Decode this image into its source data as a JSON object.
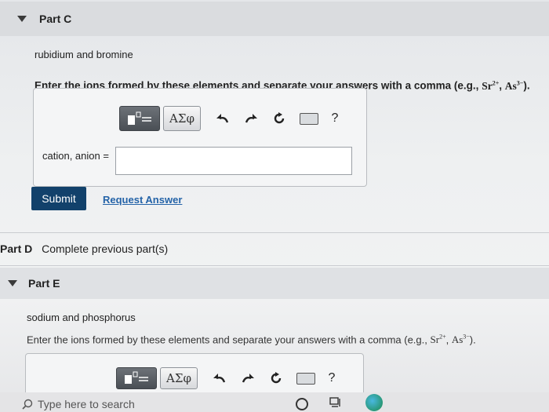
{
  "part_c": {
    "title": "Part C",
    "elements": "rubidium and bromine",
    "instruction": "Enter the ions formed by these elements and separate your answers with a comma (e.g.,",
    "example_a": "Sr",
    "example_a_sup": "2+",
    "example_sep": ",",
    "example_b": "As",
    "example_b_sup": "3−",
    "example_end": ").",
    "toolbar": {
      "greek_label": "ΑΣφ",
      "undo_icon": "undo-arrow-icon",
      "redo_icon": "redo-arrow-icon",
      "reset_icon": "reset-icon",
      "keyboard_icon": "keyboard-icon",
      "help_label": "?"
    },
    "field_label": "cation, anion =",
    "field_value": "",
    "submit_label": "Submit",
    "request_label": "Request Answer"
  },
  "part_d": {
    "title": "Part D",
    "status": "Complete previous part(s)"
  },
  "part_e": {
    "title": "Part E",
    "elements": "sodium and phosphorus",
    "instruction": "Enter the ions formed by these elements and separate your answers with a comma (e.g.,",
    "example_a": "Sr",
    "example_a_sup": "2+",
    "example_sep": ",",
    "example_b": "As",
    "example_b_sup": "3−",
    "example_end": ").",
    "toolbar": {
      "greek_label": "ΑΣφ",
      "help_label": "?"
    }
  },
  "taskbar": {
    "search_placeholder": "Type here to search"
  },
  "colors": {
    "submit_bg": "#12416b",
    "link": "#2463a8",
    "header_bg": "#dadcdf"
  }
}
